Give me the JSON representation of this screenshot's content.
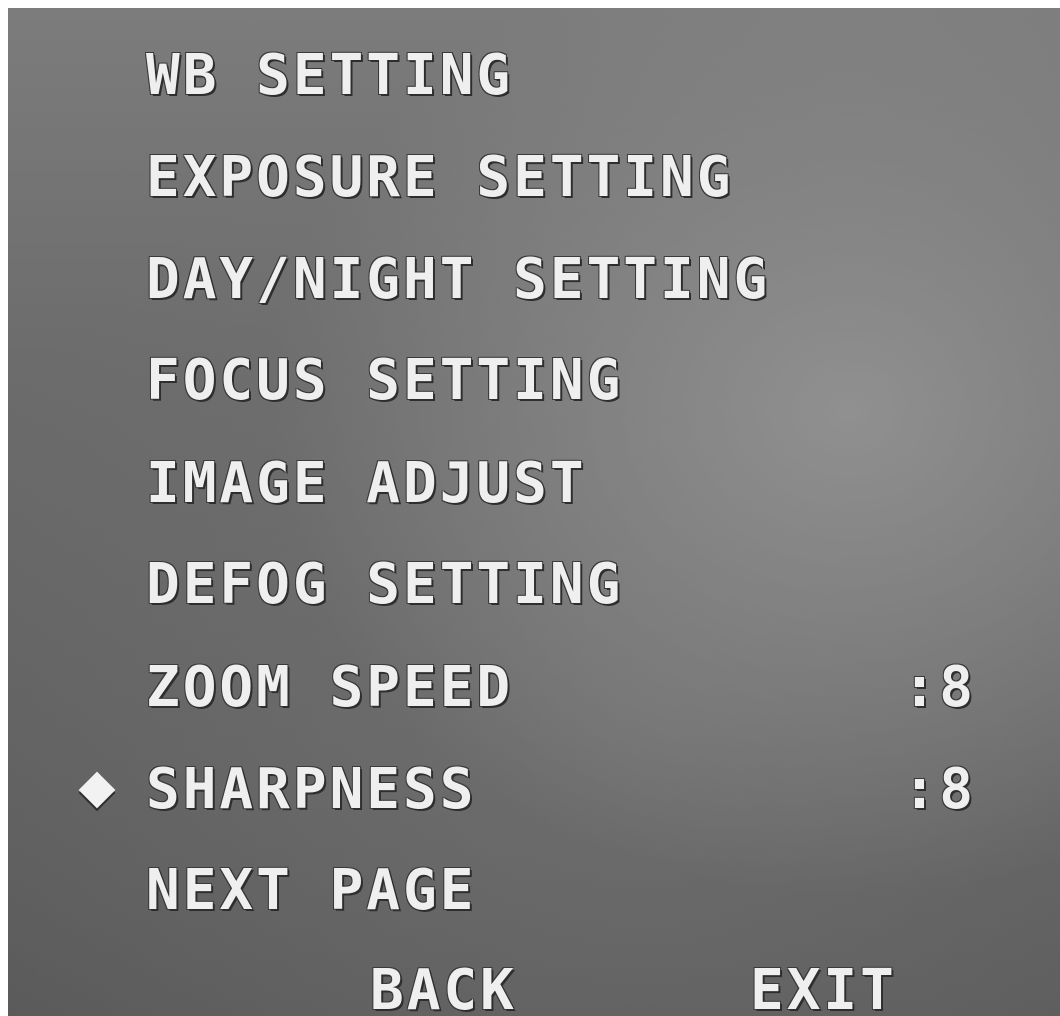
{
  "menu": {
    "items": [
      {
        "label": "WB SETTING",
        "value": ""
      },
      {
        "label": "EXPOSURE SETTING",
        "value": ""
      },
      {
        "label": "DAY/NIGHT SETTING",
        "value": ""
      },
      {
        "label": "FOCUS SETTING",
        "value": ""
      },
      {
        "label": "IMAGE ADJUST",
        "value": ""
      },
      {
        "label": "DEFOG SETTING",
        "value": ""
      },
      {
        "label": "ZOOM SPEED",
        "value": ":8"
      },
      {
        "label": "SHARPNESS",
        "value": ":8",
        "selected": true
      },
      {
        "label": "NEXT PAGE",
        "value": ""
      }
    ]
  },
  "footer": {
    "back_label": "BACK",
    "exit_label": "EXIT"
  },
  "cursor": {
    "icon": "diamond-cursor-icon",
    "selected_item": "SHARPNESS"
  },
  "colors": {
    "text": "#efefef",
    "background": "#6a6a6a"
  }
}
